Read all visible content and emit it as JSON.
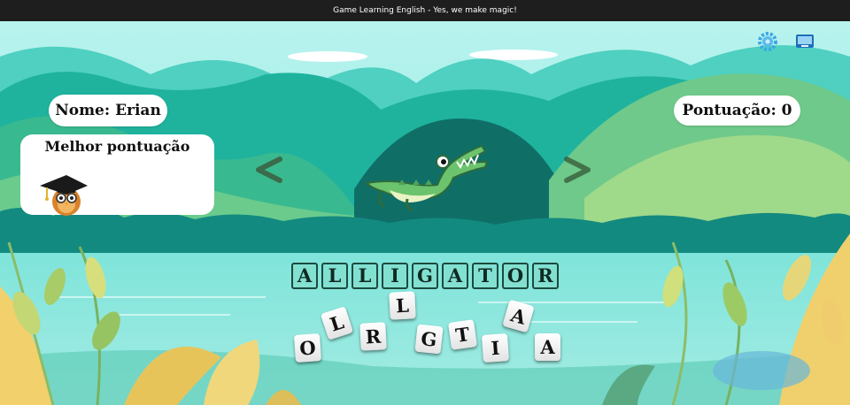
{
  "header": {
    "title": "Game Learning English - Yes, we make magic!"
  },
  "player": {
    "name_label": "Nome: Erian",
    "score_label": "Pontuação: 0"
  },
  "best_score": {
    "title": "Melhor pontuação"
  },
  "icons": {
    "settings": "gear-icon",
    "fullscreen": "screen-icon",
    "prev": "chevron-left-icon",
    "next": "chevron-right-icon",
    "mascot": "owl-graduate-icon",
    "animal": "alligator-icon"
  },
  "colors": {
    "sky": "#8eeae4",
    "water": "#74dfd6",
    "forest": "#1aa88f",
    "slot_border": "#1c4a3e"
  },
  "word": {
    "answer": "ALLIGATOR",
    "slots": [
      "A",
      "L",
      "L",
      "I",
      "G",
      "A",
      "T",
      "O",
      "R"
    ]
  },
  "tiles": [
    "O",
    "L",
    "R",
    "L",
    "G",
    "T",
    "I",
    "A",
    "A"
  ]
}
